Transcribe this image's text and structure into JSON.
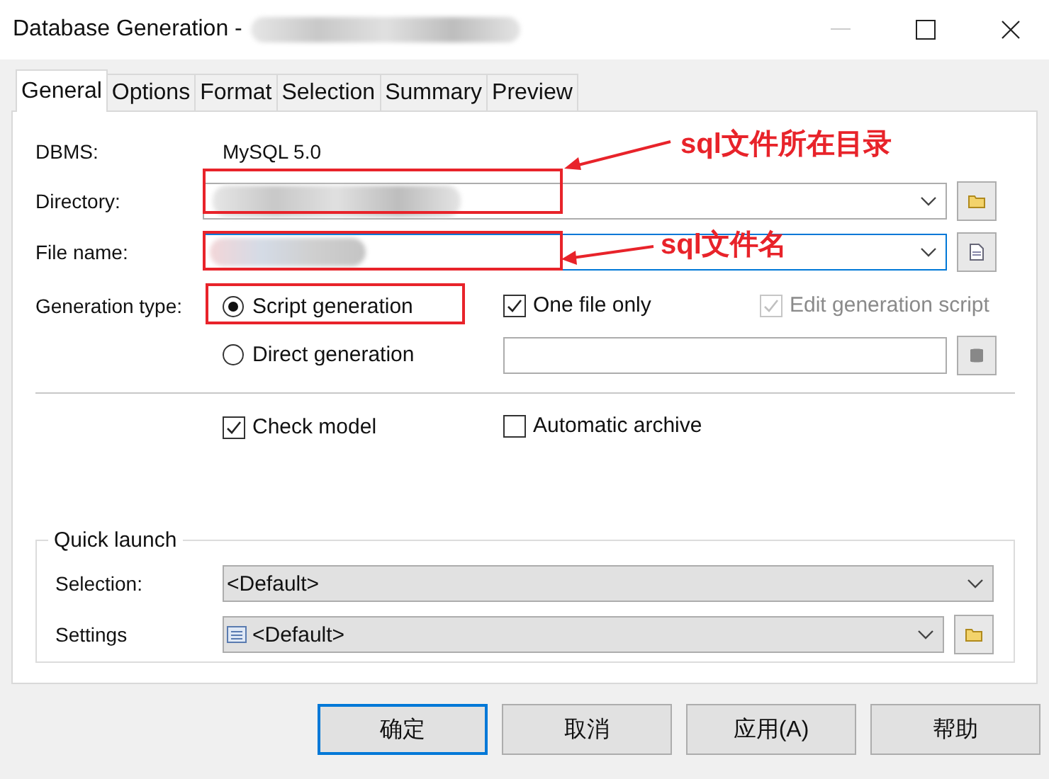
{
  "window": {
    "title": "Database Generation -"
  },
  "tabs": [
    {
      "label": "General",
      "selected": true
    },
    {
      "label": "Options",
      "selected": false
    },
    {
      "label": "Format",
      "selected": false
    },
    {
      "label": "Selection",
      "selected": false
    },
    {
      "label": "Summary",
      "selected": false
    },
    {
      "label": "Preview",
      "selected": false
    }
  ],
  "general": {
    "dbms_label": "DBMS:",
    "dbms_value": "MySQL 5.0",
    "directory": {
      "label": "Directory:",
      "focused": false
    },
    "file_name": {
      "label": "File name:",
      "focused": true
    },
    "generation_type_label": "Generation type:",
    "generation_types": [
      {
        "label": "Script generation",
        "selected": true
      },
      {
        "label": "Direct generation",
        "selected": false
      }
    ],
    "one_file_only": {
      "label": "One file only",
      "checked": true,
      "disabled": false
    },
    "edit_generation_script": {
      "label": "Edit generation script",
      "checked": true,
      "disabled": true
    },
    "check_model": {
      "label": "Check model",
      "checked": true,
      "disabled": false
    },
    "automatic_archive": {
      "label": "Automatic archive",
      "checked": false,
      "disabled": false
    }
  },
  "quick_launch": {
    "title": "Quick launch",
    "selection": {
      "label": "Selection:",
      "value": "<Default>"
    },
    "settings": {
      "label": "Settings",
      "value": "<Default>"
    }
  },
  "buttons": [
    {
      "label": "确定",
      "default": true
    },
    {
      "label": "取消",
      "default": false
    },
    {
      "label": "应用(A)",
      "default": false
    },
    {
      "label": "帮助",
      "default": false
    }
  ],
  "annotations": [
    {
      "text": "sql文件所在目录"
    },
    {
      "text": "sql文件名"
    }
  ]
}
